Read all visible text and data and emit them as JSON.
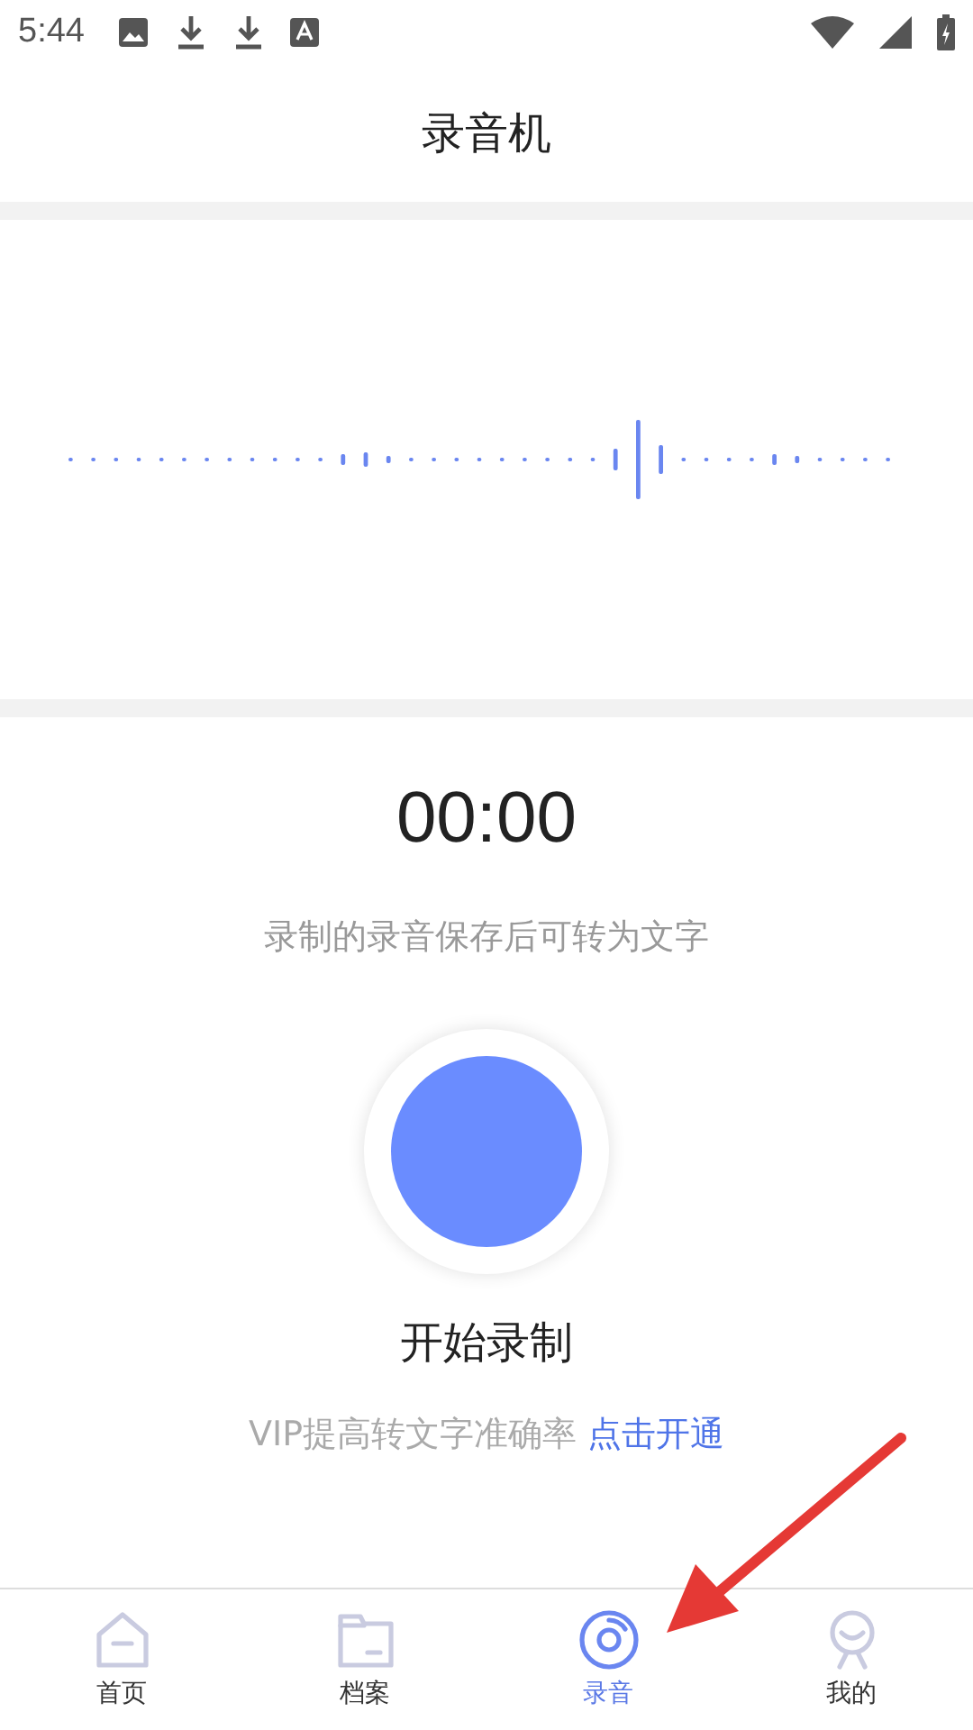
{
  "status_bar": {
    "time": "5:44"
  },
  "header": {
    "title": "录音机"
  },
  "recorder": {
    "timer": "00:00",
    "hint": "录制的录音保存后可转为文字",
    "record_label": "开始录制",
    "vip_text": "VIP提高转文字准确率",
    "vip_link": "点击开通"
  },
  "tabs": [
    {
      "label": "首页",
      "kind": "home",
      "selected": false
    },
    {
      "label": "档案",
      "kind": "folder",
      "selected": false
    },
    {
      "label": "录音",
      "kind": "record",
      "selected": true
    },
    {
      "label": "我的",
      "kind": "person",
      "selected": false
    }
  ]
}
